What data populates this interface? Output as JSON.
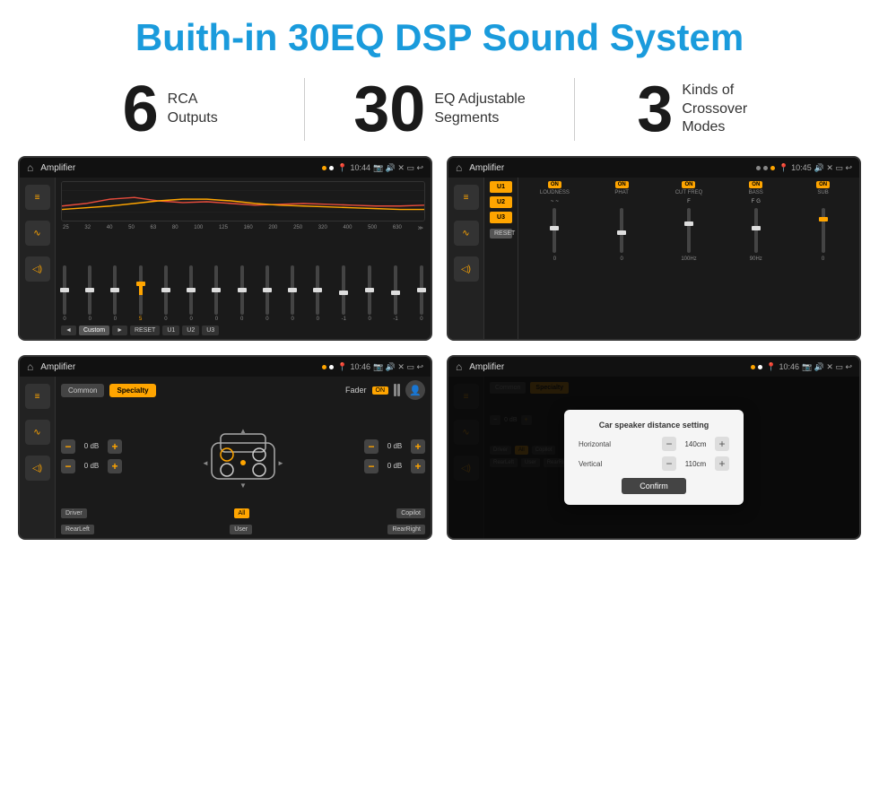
{
  "header": {
    "title": "Buith-in 30EQ DSP Sound System"
  },
  "stats": [
    {
      "number": "6",
      "label": "RCA\nOutputs"
    },
    {
      "number": "30",
      "label": "EQ Adjustable\nSegments"
    },
    {
      "number": "3",
      "label": "Kinds of\nCrossover Modes"
    }
  ],
  "screens": [
    {
      "id": "eq-screen",
      "status_bar": {
        "app": "Amplifier",
        "time": "10:44"
      }
    },
    {
      "id": "crossover-screen",
      "status_bar": {
        "app": "Amplifier",
        "time": "10:45"
      }
    },
    {
      "id": "fader-screen",
      "status_bar": {
        "app": "Amplifier",
        "time": "10:46"
      }
    },
    {
      "id": "dialog-screen",
      "status_bar": {
        "app": "Amplifier",
        "time": "10:46"
      },
      "dialog": {
        "title": "Car speaker distance setting",
        "horizontal_label": "Horizontal",
        "horizontal_value": "140cm",
        "vertical_label": "Vertical",
        "vertical_value": "110cm",
        "confirm_label": "Confirm"
      }
    }
  ],
  "eq": {
    "frequencies": [
      "25",
      "32",
      "40",
      "50",
      "63",
      "80",
      "100",
      "125",
      "160",
      "200",
      "250",
      "320",
      "400",
      "500",
      "630"
    ],
    "values": [
      "0",
      "0",
      "0",
      "5",
      "0",
      "0",
      "0",
      "0",
      "0",
      "0",
      "0",
      "-1",
      "0",
      "-1"
    ],
    "buttons": [
      "Custom",
      "RESET",
      "U1",
      "U2",
      "U3"
    ]
  },
  "crossover": {
    "presets": [
      "U1",
      "U2",
      "U3"
    ],
    "channels": [
      {
        "name": "LOUDNESS",
        "toggle": "ON"
      },
      {
        "name": "PHAT",
        "toggle": "ON"
      },
      {
        "name": "CUT FREQ",
        "toggle": "ON"
      },
      {
        "name": "BASS",
        "toggle": "ON"
      },
      {
        "name": "SUB",
        "toggle": "ON"
      }
    ],
    "reset_label": "RESET"
  },
  "fader": {
    "tabs": [
      "Common",
      "Specialty"
    ],
    "active_tab": "Specialty",
    "fader_label": "Fader",
    "toggle": "ON",
    "buttons_bottom": [
      "Driver",
      "",
      "Copilot",
      "RearLeft",
      "All",
      "User",
      "RearRight"
    ]
  },
  "dialog": {
    "title": "Car speaker distance setting",
    "horizontal_label": "Horizontal",
    "horizontal_value": "140cm",
    "vertical_label": "Vertical",
    "vertical_value": "110cm",
    "confirm_label": "Confirm"
  }
}
